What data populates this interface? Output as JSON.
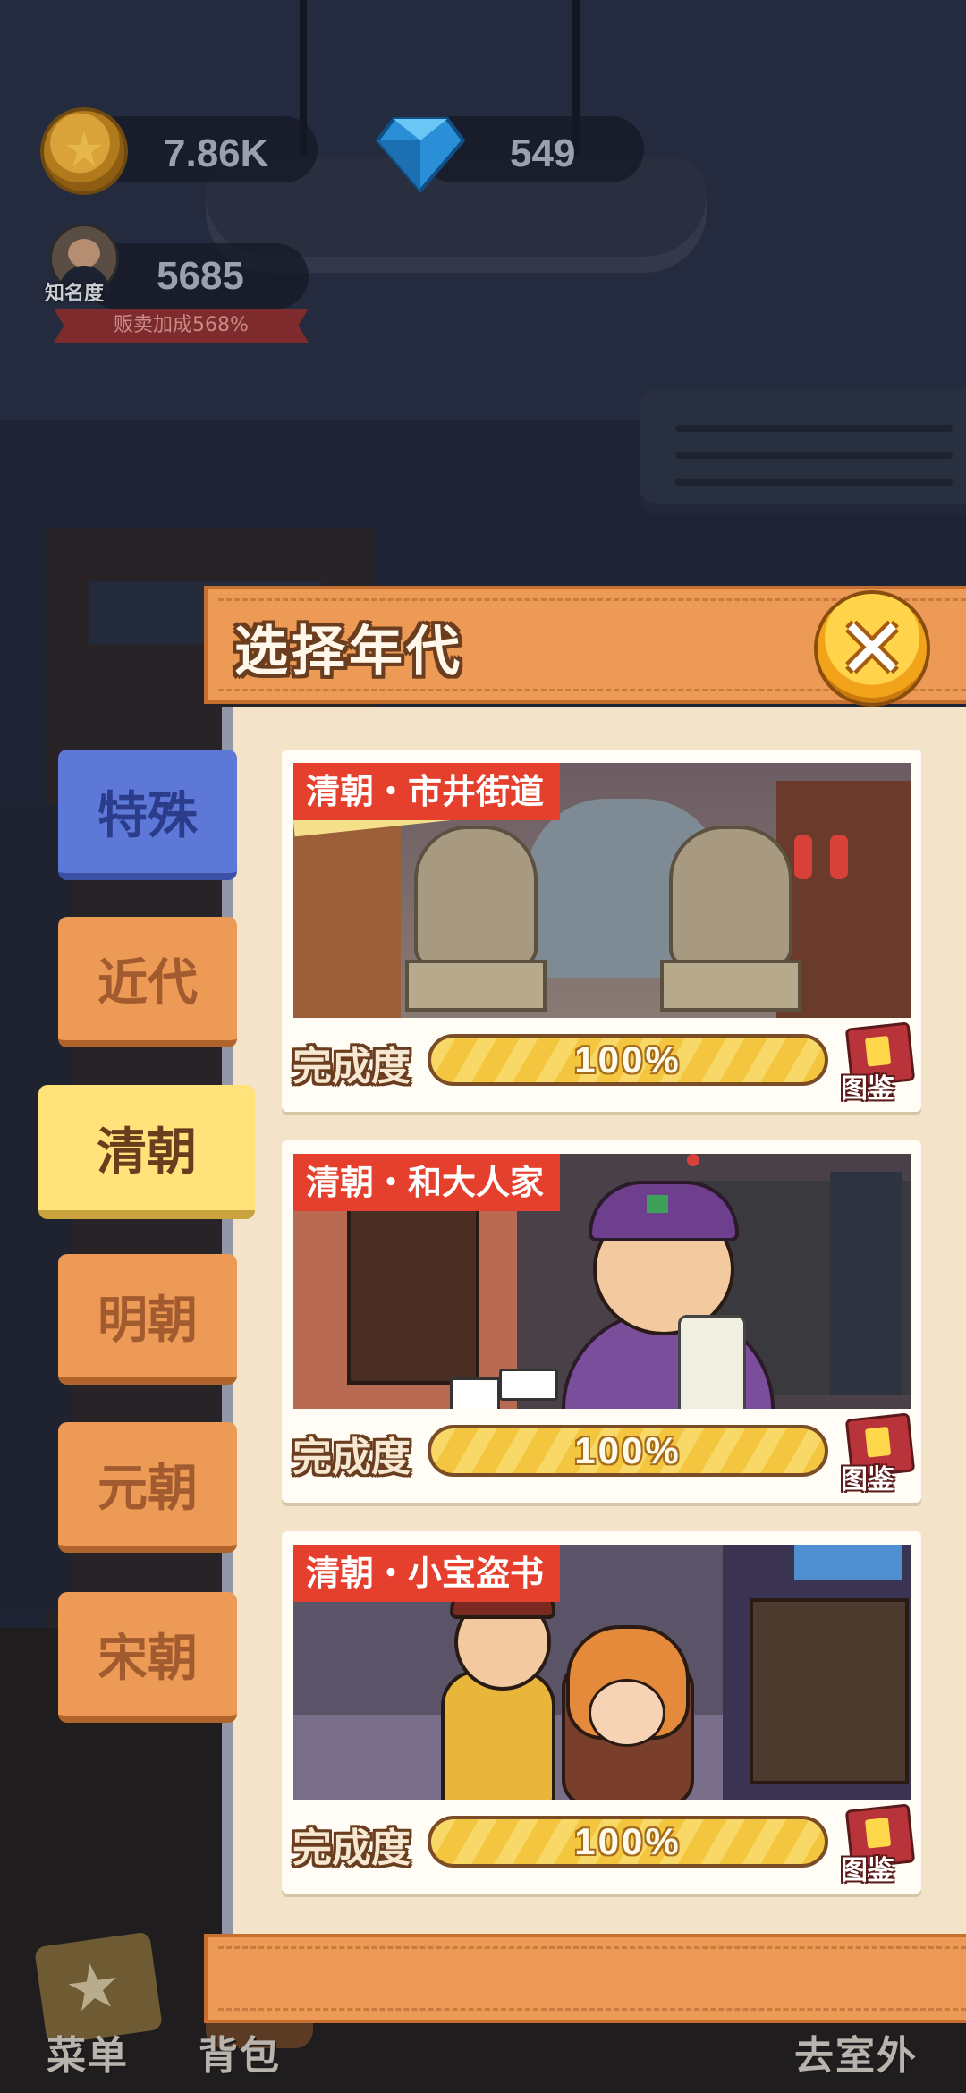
{
  "hud": {
    "coins": "7.86K",
    "gems": "549",
    "fame_label": "知名度",
    "fame_value": "5685",
    "sell_bonus": "贩卖加成568%"
  },
  "panel": {
    "title": "选择年代",
    "close_icon": "close-icon"
  },
  "tabs": [
    {
      "label": "特殊",
      "active": false
    },
    {
      "label": "近代",
      "active": false
    },
    {
      "label": "清朝",
      "active": true
    },
    {
      "label": "明朝",
      "active": false
    },
    {
      "label": "元朝",
      "active": false
    },
    {
      "label": "宋朝",
      "active": false
    }
  ],
  "levels": [
    {
      "tag": "清朝・市井街道",
      "completion_label": "完成度",
      "progress": "100%",
      "progress_value": 1.0,
      "catalog_label": "图鉴"
    },
    {
      "tag": "清朝・和大人家",
      "completion_label": "完成度",
      "progress": "100%",
      "progress_value": 1.0,
      "catalog_label": "图鉴"
    },
    {
      "tag": "清朝・小宝盗书",
      "completion_label": "完成度",
      "progress": "100%",
      "progress_value": 1.0,
      "catalog_label": "图鉴"
    }
  ],
  "bottom_nav": {
    "menu": "菜单",
    "bag": "背包",
    "outside": "去室外"
  },
  "colors": {
    "panel_orange": "#ec9a55",
    "panel_body": "#f3e4c9",
    "tab_active": "#ffe27a",
    "tab_special": "#5e78d8",
    "tag_red": "#e5402d",
    "progress_yellow": "#f4c63f"
  }
}
